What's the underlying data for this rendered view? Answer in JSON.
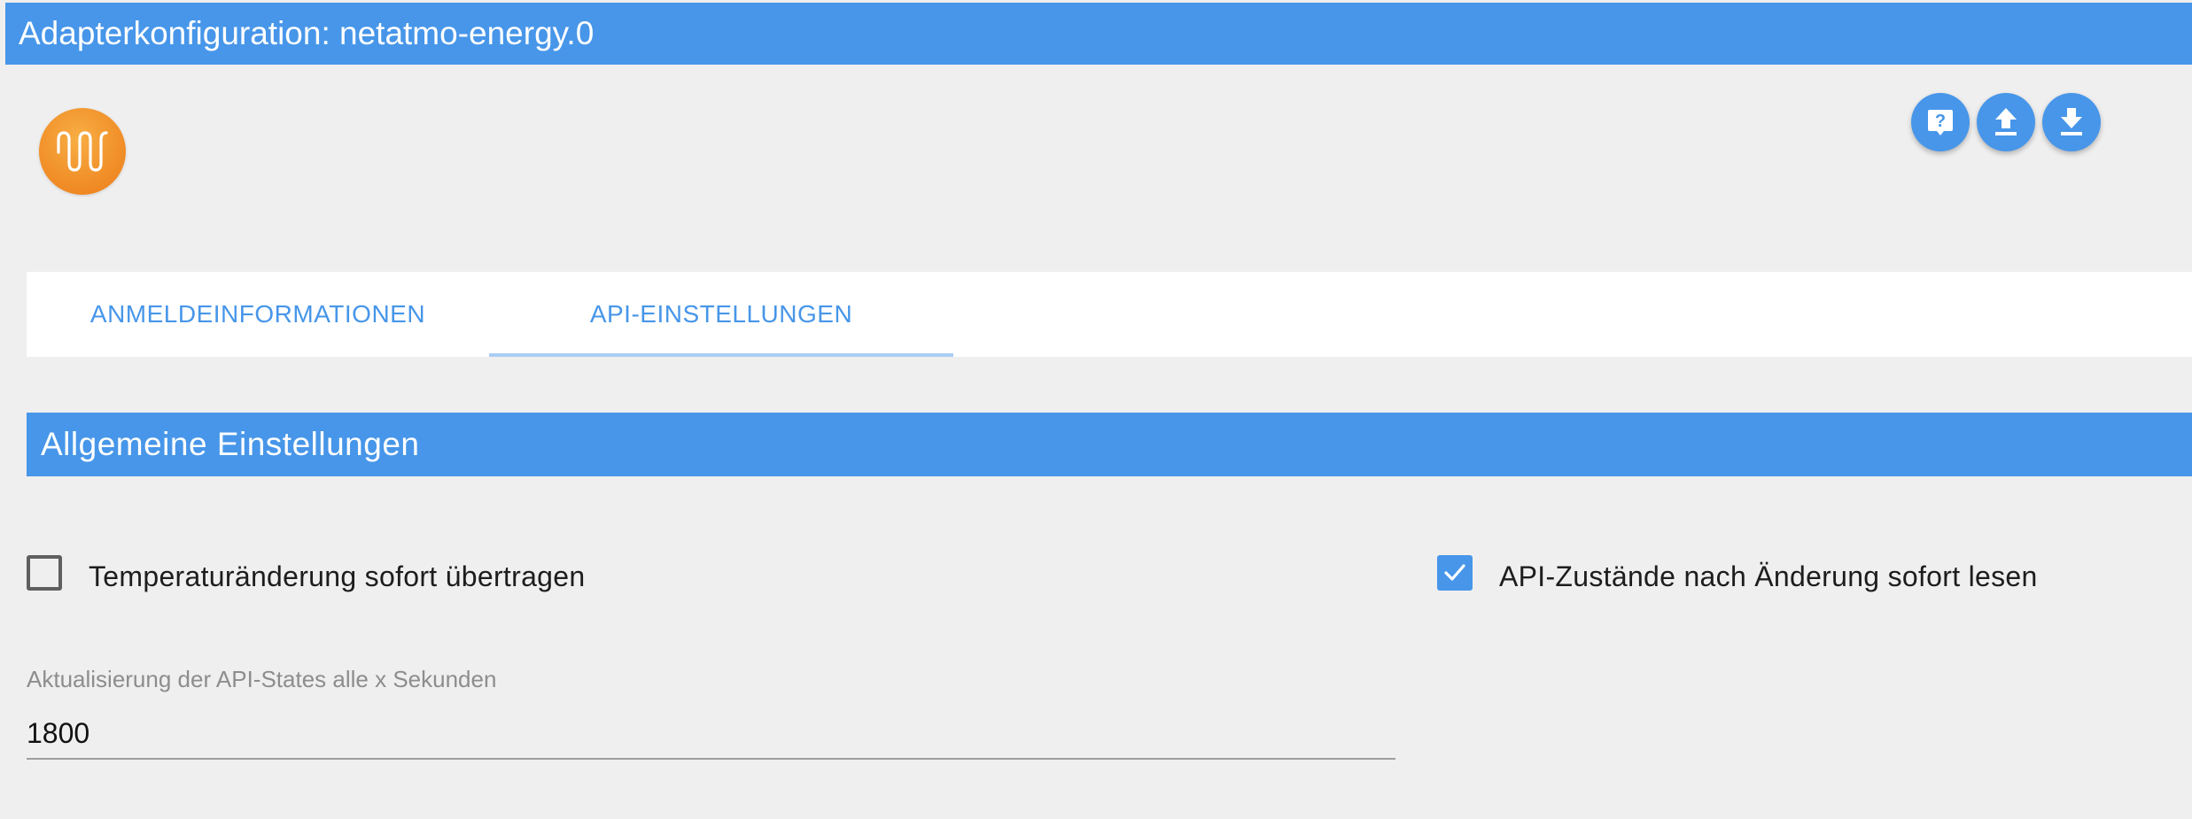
{
  "window": {
    "title": "Adapterkonfiguration: netatmo-energy.0"
  },
  "logo": {
    "icon": "heating-wave-icon",
    "color": "#f08a24"
  },
  "toolbar": {
    "buttons": [
      {
        "name": "help-button",
        "icon": "help-icon"
      },
      {
        "name": "upload-button",
        "icon": "upload-icon"
      },
      {
        "name": "download-button",
        "icon": "download-icon"
      }
    ]
  },
  "tabs": [
    {
      "label": "ANMELDEINFORMATIONEN",
      "active": false
    },
    {
      "label": "API-EINSTELLUNGEN",
      "active": true
    }
  ],
  "section": {
    "title": "Allgemeine Einstellungen"
  },
  "options": {
    "temp_change": {
      "label": "Temperaturänderung sofort übertragen",
      "checked": false
    },
    "api_states": {
      "label": "API-Zustände nach Änderung sofort lesen",
      "checked": true
    }
  },
  "refresh": {
    "label": "Aktualisierung der API-States alle x Sekunden",
    "value": "1800"
  },
  "colors": {
    "accent": "#4796e9",
    "background": "#efefef",
    "tab_indicator": "#a9cdf4"
  }
}
